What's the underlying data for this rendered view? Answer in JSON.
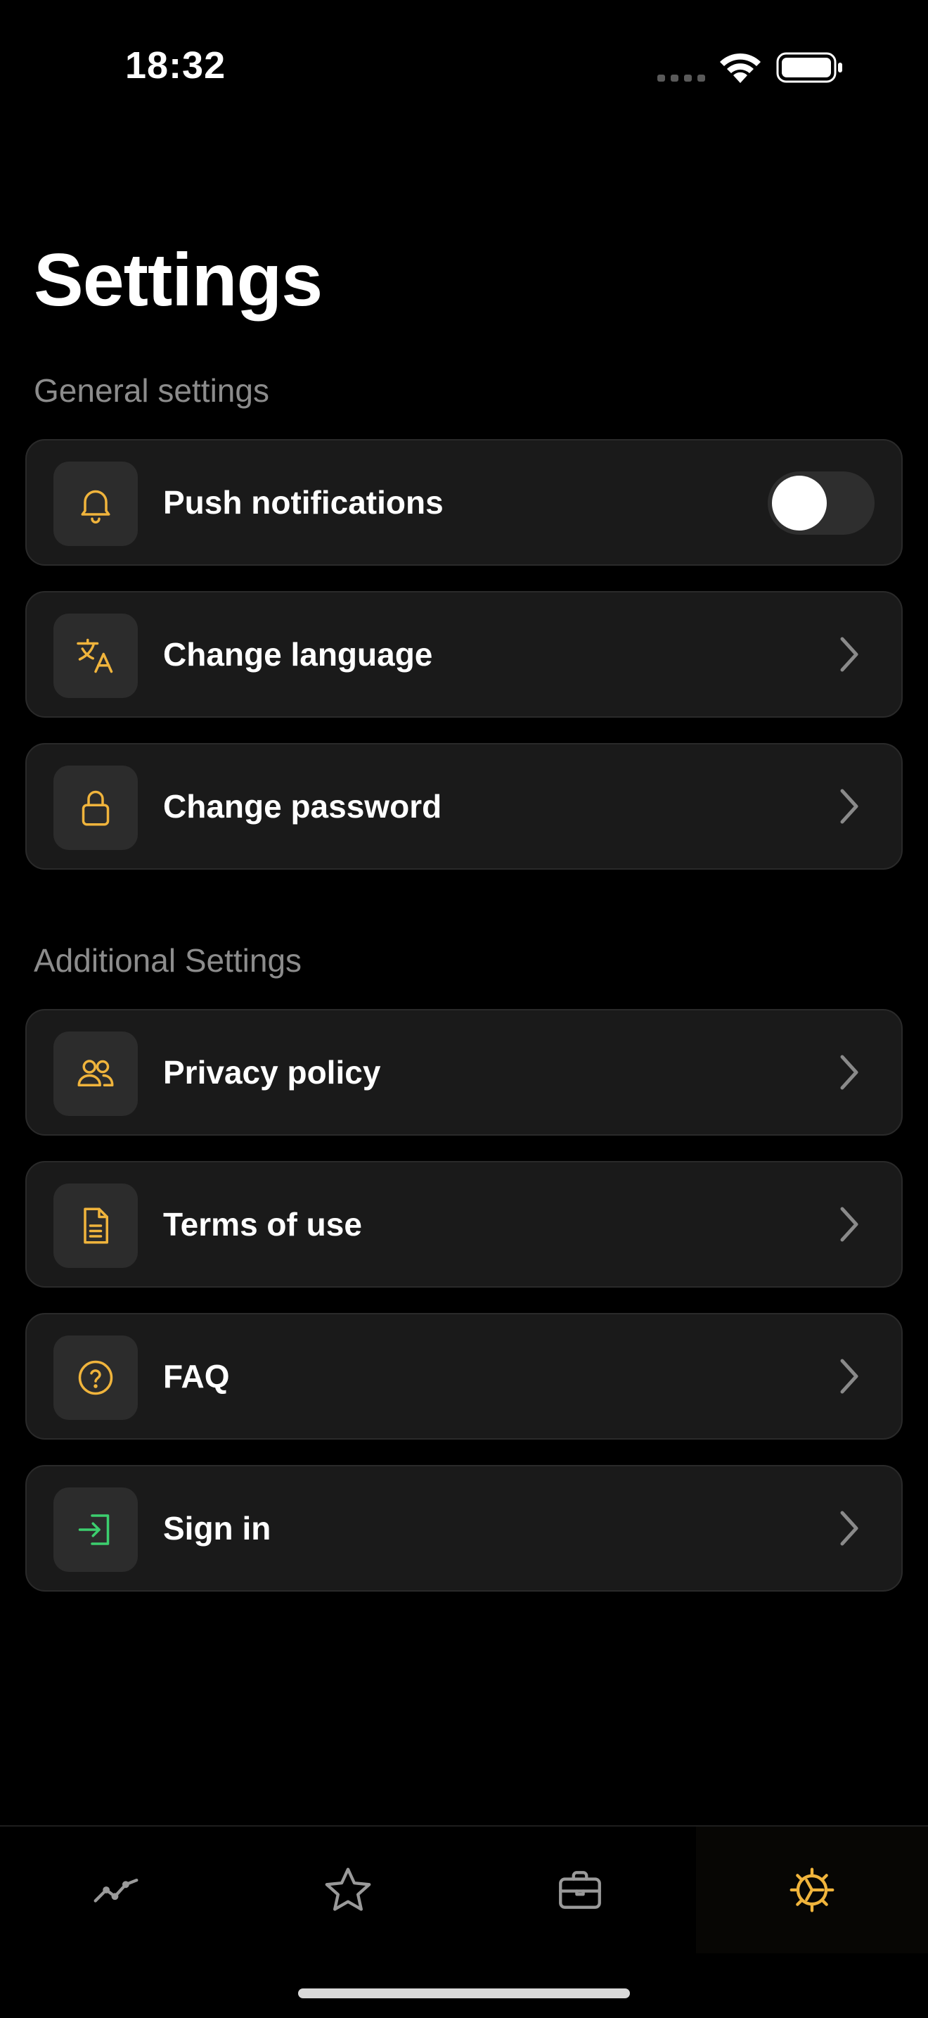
{
  "status_bar": {
    "time": "18:32",
    "icons": [
      "signal-dots-icon",
      "wifi-icon",
      "battery-icon"
    ]
  },
  "page": {
    "title": "Settings"
  },
  "sections": {
    "general": {
      "header": "General settings",
      "items": [
        {
          "label": "Push notifications",
          "icon": "bell-icon",
          "control": "toggle",
          "toggle_on": false
        },
        {
          "label": "Change language",
          "icon": "translate-icon",
          "control": "chevron"
        },
        {
          "label": "Change password",
          "icon": "lock-icon",
          "control": "chevron"
        }
      ]
    },
    "additional": {
      "header": "Additional Settings",
      "items": [
        {
          "label": "Privacy policy",
          "icon": "users-icon",
          "control": "chevron"
        },
        {
          "label": "Terms of use",
          "icon": "document-icon",
          "control": "chevron"
        },
        {
          "label": "FAQ",
          "icon": "question-icon",
          "control": "chevron"
        },
        {
          "label": "Sign in",
          "icon": "sign-in-icon",
          "control": "chevron"
        }
      ]
    }
  },
  "tab_bar": {
    "tabs": [
      {
        "icon": "chart-line-icon",
        "active": false
      },
      {
        "icon": "star-icon",
        "active": false
      },
      {
        "icon": "briefcase-icon",
        "active": false
      },
      {
        "icon": "gear-icon",
        "active": true
      }
    ]
  },
  "colors": {
    "background": "#000000",
    "card": "#1a1a1a",
    "accent": "#f0b43c",
    "sign_in_accent": "#3ccf6e",
    "secondary_text": "#8c8c8c",
    "inactive_icon": "#9a9a9a"
  }
}
